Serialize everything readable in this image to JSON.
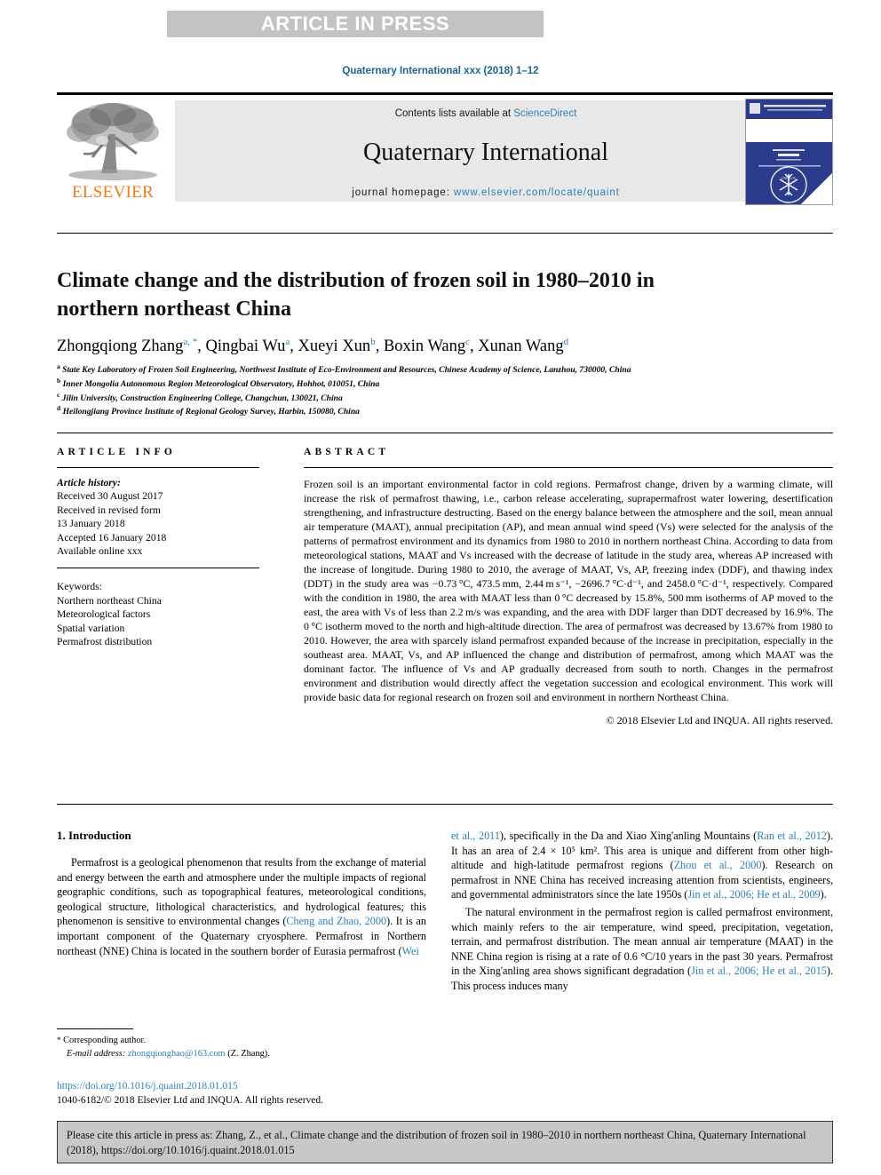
{
  "banner": {
    "text": "ARTICLE IN PRESS"
  },
  "journal_ref": "Quaternary International xxx (2018) 1–12",
  "masthead": {
    "publisher": "ELSEVIER",
    "contents_prefix": "Contents lists available at ",
    "contents_link": "ScienceDirect",
    "journal_title": "Quaternary International",
    "homepage_label": "journal homepage: ",
    "homepage_url": "www.elsevier.com/locate/quaint"
  },
  "article": {
    "title": "Climate change and the distribution of frozen soil in 1980–2010 in northern northeast China",
    "authors": [
      {
        "name": "Zhongqiong Zhang",
        "sup": "a, *"
      },
      {
        "name": "Qingbai Wu",
        "sup": "a"
      },
      {
        "name": "Xueyi Xun",
        "sup": "b"
      },
      {
        "name": "Boxin Wang",
        "sup": "c"
      },
      {
        "name": "Xunan Wang",
        "sup": "d"
      }
    ],
    "affiliations": [
      {
        "marker": "a",
        "text": "State Key Laboratory of Frozen Soil Engineering, Northwest Institute of Eco-Environment and Resources, Chinese Academy of Science, Lanzhou, 730000, China"
      },
      {
        "marker": "b",
        "text": "Inner Mongolia Autonomous Region Meteorological Observatory, Hohhot, 010051, China"
      },
      {
        "marker": "c",
        "text": "Jilin University, Construction Engineering College, Changchun, 130021, China"
      },
      {
        "marker": "d",
        "text": "Heilongjiang Province Institute of Regional Geology Survey, Harbin, 150080, China"
      }
    ]
  },
  "article_info": {
    "heading": "ARTICLE INFO",
    "history_label": "Article history:",
    "history": [
      "Received 30 August 2017",
      "Received in revised form",
      "13 January 2018",
      "Accepted 16 January 2018",
      "Available online xxx"
    ],
    "keywords_label": "Keywords:",
    "keywords": [
      "Northern northeast China",
      "Meteorological factors",
      "Spatial variation",
      "Permafrost distribution"
    ]
  },
  "abstract": {
    "heading": "ABSTRACT",
    "text": "Frozen soil is an important environmental factor in cold regions. Permafrost change, driven by a warming climate, will increase the risk of permafrost thawing, i.e., carbon release accelerating, suprapermafrost water lowering, desertification strengthening, and infrastructure destructing. Based on the energy balance between the atmosphere and the soil, mean annual air temperature (MAAT), annual precipitation (AP), and mean annual wind speed (Vs) were selected for the analysis of the patterns of permafrost environment and its dynamics from 1980 to 2010 in northern northeast China. According to data from meteorological stations, MAAT and Vs increased with the decrease of latitude in the study area, whereas AP increased with the increase of longitude. During 1980 to 2010, the average of MAAT, Vs, AP, freezing index (DDF), and thawing index (DDT) in the study area was −0.73 °C, 473.5 mm, 2.44 m s⁻¹, −2696.7 °C·d⁻¹, and 2458.0 °C·d⁻¹, respectively. Compared with the condition in 1980, the area with MAAT less than 0 °C decreased by 15.8%, 500 mm isotherms of AP moved to the east, the area with Vs of less than 2.2 m/s was expanding, and the area with DDF larger than DDT decreased by 16.9%. The 0 °C isotherm moved to the north and high-altitude direction. The area of permafrost was decreased by 13.67% from 1980 to 2010. However, the area with sparcely island permafrost expanded because of the increase in precipitation, especially in the southeast area. MAAT, Vs, and AP influenced the change and distribution of permafrost, among which MAAT was the dominant factor. The influence of Vs and AP gradually decreased from south to north. Changes in the permafrost environment and distribution would directly affect the vegetation succession and ecological environment. This work will provide basic data for regional research on frozen soil and environment in northern Northeast China.",
    "copyright": "© 2018 Elsevier Ltd and INQUA. All rights reserved."
  },
  "introduction": {
    "heading": "1. Introduction",
    "left_paragraph_part1": "Permafrost is a geological phenomenon that results from the exchange of material and energy between the earth and atmosphere under the multiple impacts of regional geographic conditions, such as topographical features, meteorological conditions, geological structure, lithological characteristics, and hydrological features; this phenomenon is sensitive to environmental changes (",
    "cite_cheng": "Cheng and Zhao, 2000",
    "left_paragraph_part2": "). It is an important component of the Quaternary cryosphere. Permafrost in Northern northeast (NNE) China is located in the southern border of Eurasia permafrost (",
    "cite_wei": "Wei",
    "right_cont_1": "et al., 2011",
    "right_paragraph_part1": "), specifically in the Da and Xiao Xing'anling Mountains (",
    "cite_ran": "Ran et al., 2012",
    "right_paragraph_part2": "). It has an area of 2.4 × 10⁵ km². This area is unique and different from other high-altitude and high-latitude permafrost regions (",
    "cite_zhou": "Zhou et al., 2000",
    "right_paragraph_part3": "). Research on permafrost in NNE China has received increasing attention from scientists, engineers, and governmental administrators since the late 1950s (",
    "cite_jin_he": "Jin et al., 2006; He et al., 2009",
    "right_paragraph_part4": ").",
    "right_paragraph2_part1": "The natural environment in the permafrost region is called permafrost environment, which mainly refers to the air temperature, wind speed, precipitation, vegetation, terrain, and permafrost distribution. The mean annual air temperature (MAAT) in the NNE China region is rising at a rate of 0.6 °C/10 years in the past 30 years. Permafrost in the Xing'anling area shows significant degradation (",
    "cite_jin_he2": "Jin et al., 2006; He et al., 2015",
    "right_paragraph2_part2": "). This process induces many"
  },
  "footnote": {
    "corresponding": "Corresponding author.",
    "email_label": "E-mail address:",
    "email": "zhongqionghao@163.com",
    "email_suffix": "(Z. Zhang)."
  },
  "doi": "https://doi.org/10.1016/j.quaint.2018.01.015",
  "issn_line": "1040-6182/© 2018 Elsevier Ltd and INQUA. All rights reserved.",
  "cite_box": {
    "text": "Please cite this article in press as: Zhang, Z., et al., Climate change and the distribution of frozen soil in 1980–2010 in northern northeast China, Quaternary International (2018), https://doi.org/10.1016/j.quaint.2018.01.015"
  },
  "colors": {
    "link_blue": "#2d7fb8",
    "ref_blue": "#1a6496",
    "banner_gray": "#c3c3c5",
    "contents_gray": "#e8e8e8",
    "elsevier_orange": "#eb7d19",
    "cover_navy": "#2c3c8c",
    "cite_box_gray": "#c8c8c8"
  }
}
